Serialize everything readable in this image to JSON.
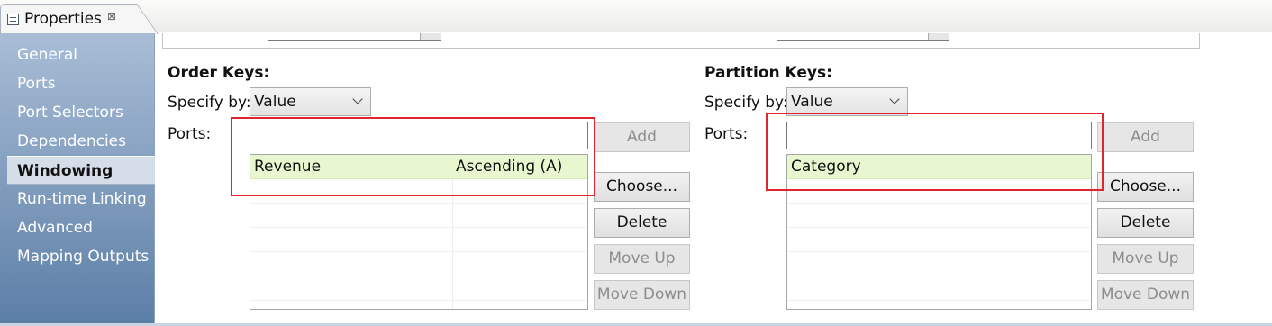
{
  "tab": {
    "title": "Properties",
    "close_glyph": "⊠"
  },
  "nav": {
    "items": [
      {
        "label": "General"
      },
      {
        "label": "Ports"
      },
      {
        "label": "Port Selectors"
      },
      {
        "label": "Dependencies"
      },
      {
        "label": "Windowing",
        "active": true
      },
      {
        "label": "Run-time Linking"
      },
      {
        "label": "Advanced"
      },
      {
        "label": "Mapping Outputs"
      }
    ]
  },
  "order_keys": {
    "title": "Order Keys:",
    "specify_label": "Specify by:",
    "specify_value": "Value",
    "ports_label": "Ports:",
    "ports_input_value": "",
    "rows": [
      {
        "port": "Revenue",
        "order": "Ascending (A)"
      }
    ],
    "buttons": {
      "add": "Add",
      "choose": "Choose...",
      "delete": "Delete",
      "move_up": "Move Up",
      "move_down": "Move Down"
    }
  },
  "partition_keys": {
    "title": "Partition Keys:",
    "specify_label": "Specify by:",
    "specify_value": "Value",
    "ports_label": "Ports:",
    "ports_input_value": "",
    "rows": [
      {
        "port": "Category"
      }
    ],
    "buttons": {
      "add": "Add",
      "choose": "Choose...",
      "delete": "Delete",
      "move_up": "Move Up",
      "move_down": "Move Down"
    }
  },
  "colors": {
    "highlight": "#e0252e",
    "selected_row": "#e8f7d0",
    "nav_top": "#a9bdd6",
    "nav_bottom": "#5b7ea6"
  }
}
